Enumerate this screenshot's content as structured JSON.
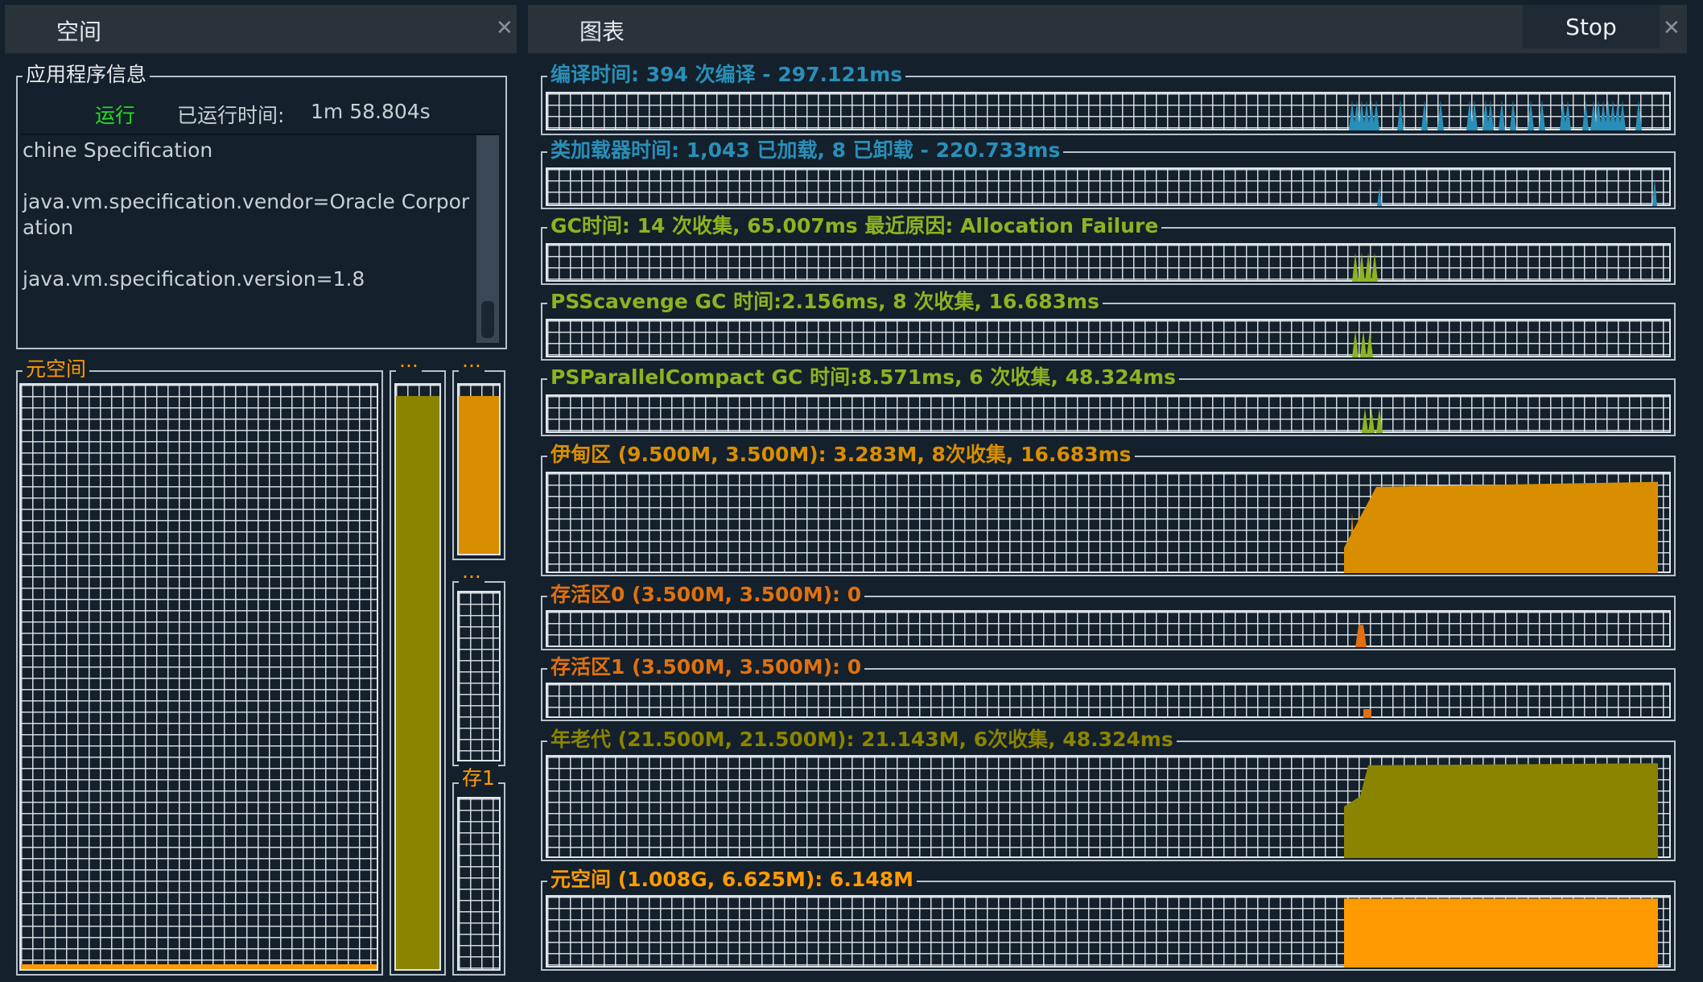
{
  "tabs": {
    "left": {
      "label": "空间"
    },
    "right": {
      "label": "图表"
    },
    "stop_label": "Stop"
  },
  "app_info": {
    "title": "应用程序信息",
    "status": "运行",
    "uptime_label": "已运行时间:",
    "uptime_value": "1m 58.804s",
    "properties": [
      "chine Specification",
      "java.vm.specification.vendor=Oracle Corpor",
      "ation",
      "java.vm.specification.version=1.8"
    ]
  },
  "spaces": {
    "metaspace_label": "元空间",
    "col2_label": "···",
    "col3_label": "···",
    "col4_label": "···",
    "col5_label": "存1"
  },
  "colors": {
    "compile": "#2a8fb8",
    "classloader": "#2a8fb8",
    "gc": "#8db320",
    "eden": "#d98e00",
    "survivor": "#e07010",
    "oldgen": "#8a8400",
    "metaspace": "#ff9a00",
    "status_running": "#22dd22"
  },
  "charts": [
    {
      "id": "compile",
      "label": "编译时间: 394 次编译 - 297.121ms"
    },
    {
      "id": "classloader",
      "label": "类加载器时间: 1,043 已加载, 8 已卸载 - 220.733ms"
    },
    {
      "id": "gc",
      "label": "GC时间: 14 次收集, 65.007ms 最近原因: Allocation Failure"
    },
    {
      "id": "psscavenge",
      "label": "PSScavenge GC 时间:2.156ms, 8 次收集, 16.683ms"
    },
    {
      "id": "psparallel",
      "label": "PSParallelCompact GC 时间:8.571ms, 6 次收集, 48.324ms"
    },
    {
      "id": "eden",
      "label": "伊甸区 (9.500M, 3.500M): 3.283M, 8次收集, 16.683ms"
    },
    {
      "id": "survivor0",
      "label": "存活区0 (3.500M, 3.500M): 0"
    },
    {
      "id": "survivor1",
      "label": "存活区1 (3.500M, 3.500M): 0"
    },
    {
      "id": "oldgen",
      "label": "年老代 (21.500M, 21.500M): 21.143M, 6次收集, 48.324ms"
    },
    {
      "id": "metaspace",
      "label": "元空间 (1.008G, 6.625M): 6.148M"
    }
  ]
}
